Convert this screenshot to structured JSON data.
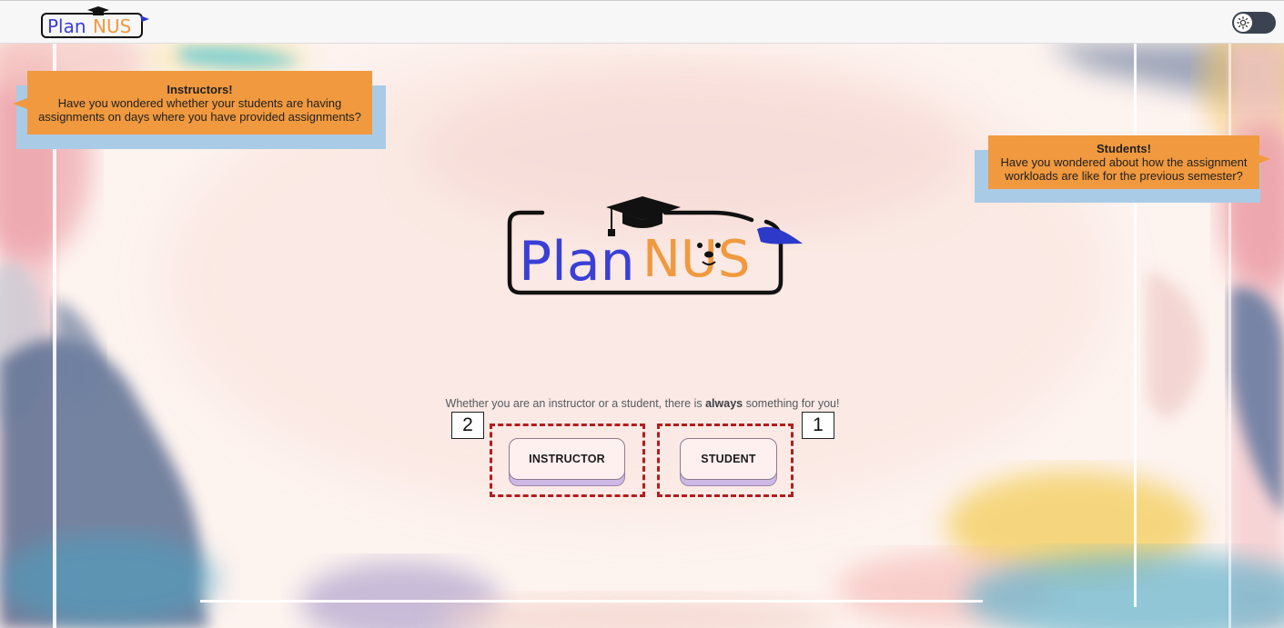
{
  "header": {
    "logo_text_left": "Plan",
    "logo_text_right": "NUS",
    "theme_toggle_icon": "sun-icon"
  },
  "callouts": {
    "instructors": {
      "title": "Instructors!",
      "line1": "Have you wondered whether your students are having",
      "line2": "assignments on days where you have provided assignments?"
    },
    "students": {
      "title": "Students!",
      "line1": "Have you wondered about how the assignment",
      "line2": "workloads are like for the previous semester?"
    }
  },
  "hero": {
    "logo_text_left": "Plan",
    "logo_text_right": "NUS"
  },
  "tagline": {
    "before": "Whether you are an instructor or a student, there is",
    "emphasis": "always",
    "after": "something for you!"
  },
  "roles": {
    "instructor_label": "INSTRUCTOR",
    "student_label": "STUDENT"
  },
  "annotations": {
    "instructor_number": "2",
    "student_number": "1"
  },
  "colors": {
    "callout": "#f0993f",
    "callout_shadow": "#a9cbe6",
    "logo_blue": "#3a3fd6",
    "logo_orange": "#f0993f",
    "highlight": "#b31d1d"
  }
}
